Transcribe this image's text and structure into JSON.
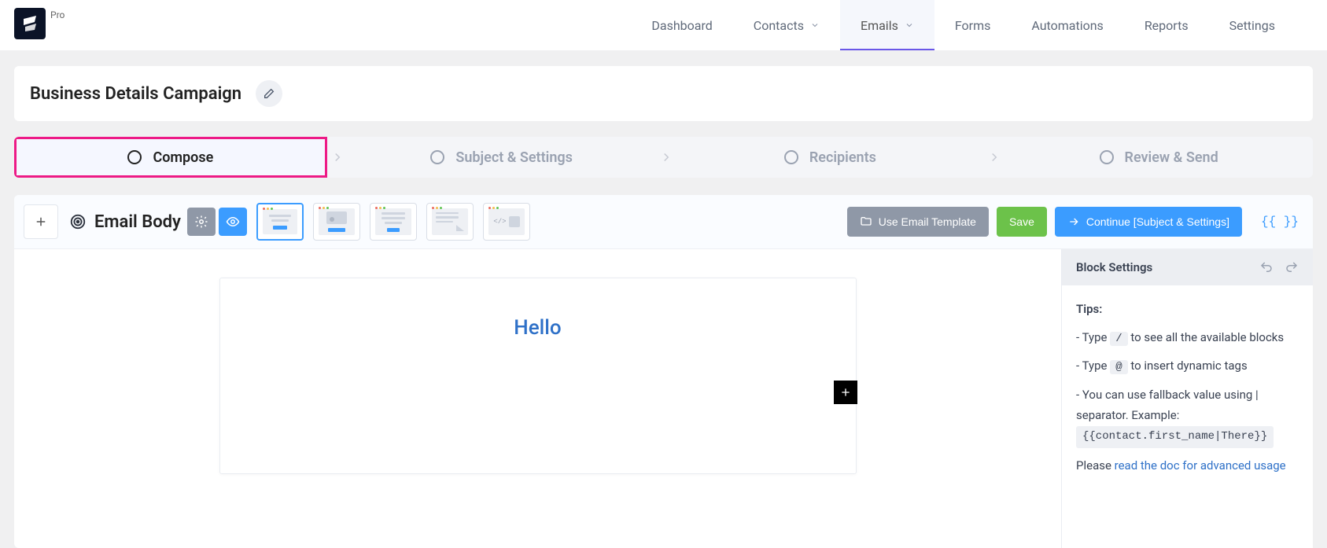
{
  "brand": {
    "pro_label": "Pro"
  },
  "nav": {
    "items": [
      {
        "label": "Dashboard",
        "has_chevron": false,
        "active": false
      },
      {
        "label": "Contacts",
        "has_chevron": true,
        "active": false
      },
      {
        "label": "Emails",
        "has_chevron": true,
        "active": true
      },
      {
        "label": "Forms",
        "has_chevron": false,
        "active": false
      },
      {
        "label": "Automations",
        "has_chevron": false,
        "active": false
      },
      {
        "label": "Reports",
        "has_chevron": false,
        "active": false
      },
      {
        "label": "Settings",
        "has_chevron": false,
        "active": false
      }
    ]
  },
  "campaign": {
    "title": "Business Details Campaign"
  },
  "steps": [
    {
      "label": "Compose",
      "active": true
    },
    {
      "label": "Subject & Settings",
      "active": false
    },
    {
      "label": "Recipients",
      "active": false
    },
    {
      "label": "Review & Send",
      "active": false
    }
  ],
  "toolbar": {
    "title": "Email Body",
    "use_template_label": "Use Email Template",
    "save_label": "Save",
    "continue_label": "Continue [Subject & Settings]",
    "merge_tag_label": "{{ }}"
  },
  "canvas": {
    "heading": "Hello"
  },
  "sidebar": {
    "title": "Block Settings",
    "tips_title": "Tips:",
    "tip1_prefix": "- Type ",
    "tip1_key": "/",
    "tip1_suffix": " to see all the available blocks",
    "tip2_prefix": "- Type ",
    "tip2_key": "@",
    "tip2_suffix": " to insert dynamic tags",
    "tip3_text": "- You can use fallback value using | separator. Example:",
    "tip3_code": "{{contact.first_name|There}}",
    "doc_prefix": "Please ",
    "doc_link": "read the doc for advanced usage"
  }
}
